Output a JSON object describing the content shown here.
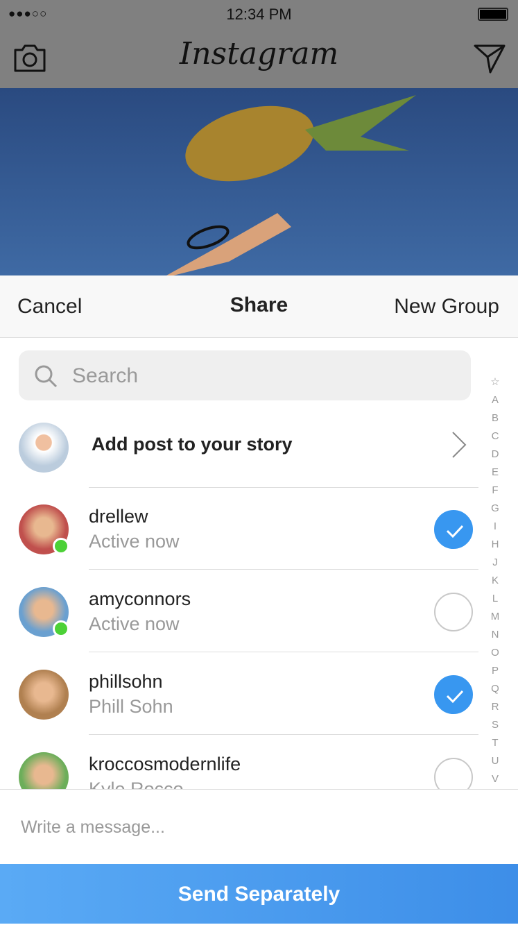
{
  "status": {
    "signal": "●●●○○",
    "time": "12:34 PM"
  },
  "app": {
    "title": "Instagram"
  },
  "share": {
    "cancel": "Cancel",
    "title": "Share",
    "new_group": "New Group"
  },
  "search": {
    "placeholder": "Search"
  },
  "story": {
    "label": "Add post to your story"
  },
  "index": [
    "☆",
    "A",
    "B",
    "C",
    "D",
    "E",
    "F",
    "G",
    "I",
    "H",
    "J",
    "K",
    "L",
    "M",
    "N",
    "O",
    "P",
    "Q",
    "R",
    "S",
    "T",
    "U",
    "V"
  ],
  "contacts": [
    {
      "name": "drellew",
      "sub": "Active now",
      "online": true,
      "selected": true
    },
    {
      "name": "amyconnors",
      "sub": "Active now",
      "online": true,
      "selected": false
    },
    {
      "name": "phillsohn",
      "sub": "Phill Sohn",
      "online": false,
      "selected": true
    },
    {
      "name": "kroccosmodernlife",
      "sub": "Kyle Rocco",
      "online": false,
      "selected": false
    }
  ],
  "message": {
    "placeholder": "Write a message..."
  },
  "send_button": "Send Separately",
  "colors": {
    "accent": "#3897f0",
    "online": "#4cd137"
  }
}
